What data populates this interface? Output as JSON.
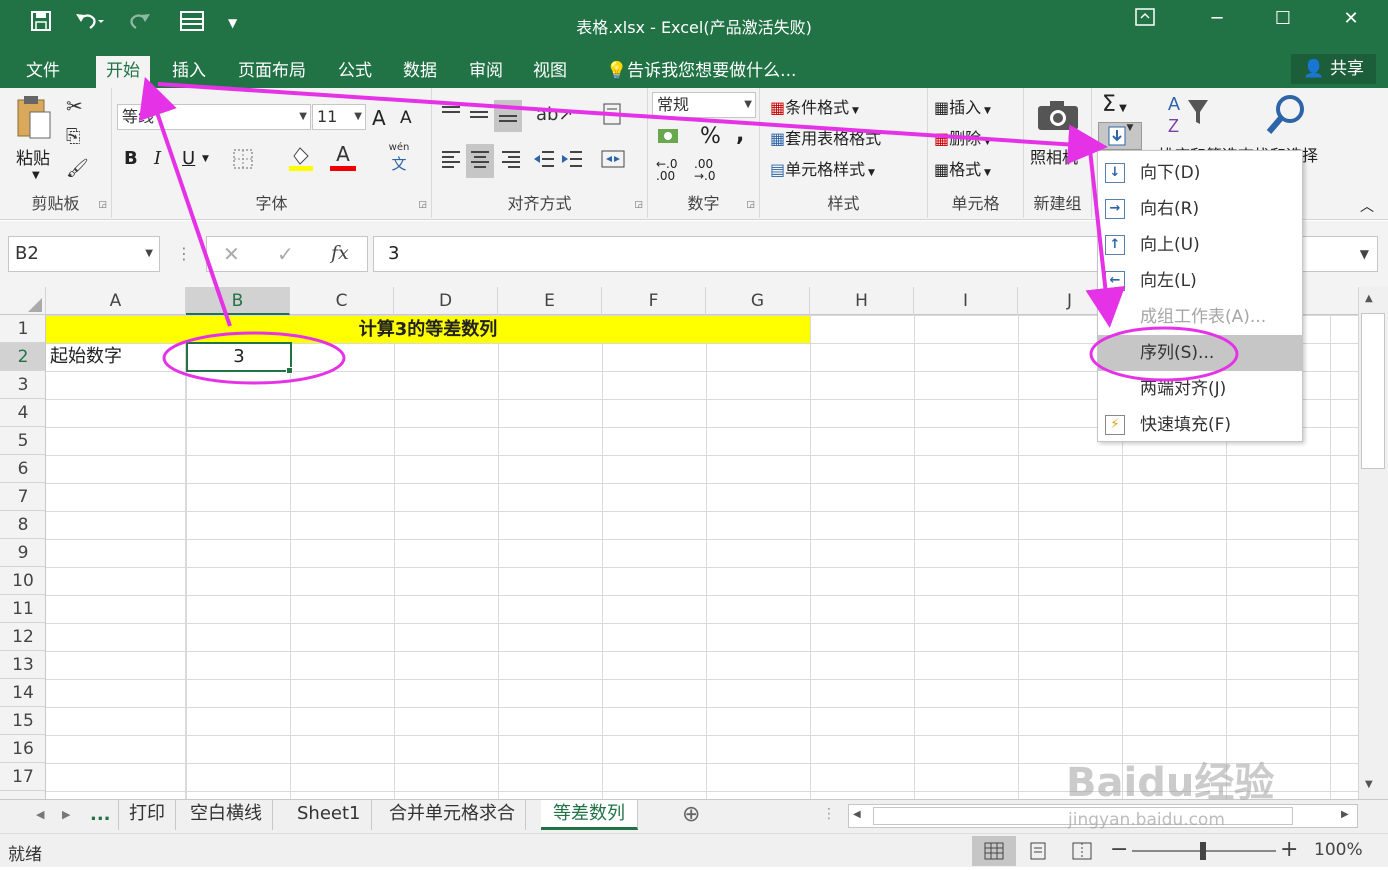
{
  "window": {
    "title": "表格.xlsx - Excel(产品激活失败)"
  },
  "quick_access": {
    "save_icon": "save-icon",
    "undo_icon": "undo-icon",
    "redo_icon": "redo-icon",
    "customize_icon": "customize-icon"
  },
  "tabs": [
    {
      "label": "文件"
    },
    {
      "label": "开始",
      "active": true
    },
    {
      "label": "插入"
    },
    {
      "label": "页面布局"
    },
    {
      "label": "公式"
    },
    {
      "label": "数据"
    },
    {
      "label": "审阅"
    },
    {
      "label": "视图"
    }
  ],
  "tell_me": "告诉我您想要做什么...",
  "share": "共享",
  "ribbon": {
    "clipboard": {
      "label": "剪贴板",
      "paste": "粘贴"
    },
    "font": {
      "label": "字体",
      "font_name": "等线",
      "font_size": "11",
      "grow": "A",
      "shrink": "A",
      "bold": "B",
      "italic": "I",
      "underline": "U",
      "font_color_letter": "A",
      "phonetic": "wén",
      "phonetic_char": "文"
    },
    "alignment": {
      "label": "对齐方式"
    },
    "number": {
      "label": "数字",
      "format": "常规",
      "percent": "%",
      "comma": ",",
      "inc_decimal_top": "←.0",
      "inc_decimal_bottom": ".00",
      "dec_decimal_top": ".00",
      "dec_decimal_bottom": "→.0"
    },
    "styles": {
      "label": "样式",
      "conditional": "条件格式",
      "table": "套用表格格式",
      "cell_styles": "单元格样式"
    },
    "cells": {
      "label": "单元格",
      "insert": "插入",
      "delete": "删除",
      "format": "格式"
    },
    "new_group": {
      "label": "新建组",
      "camera": "照相机"
    },
    "editing": {
      "sum": "Σ",
      "sort": "排序和筛选",
      "find": "查找和选择"
    }
  },
  "formula_bar": {
    "name_box": "B2",
    "fx": "fx",
    "value": "3"
  },
  "columns": [
    "A",
    "B",
    "C",
    "D",
    "E",
    "F",
    "G",
    "H",
    "I",
    "J"
  ],
  "rows": [
    "1",
    "2",
    "3",
    "4",
    "5",
    "6",
    "7",
    "8",
    "9",
    "10",
    "11",
    "12",
    "13",
    "14",
    "15",
    "16",
    "17"
  ],
  "cells": {
    "title": "计算3的等差数列",
    "a2": "起始数字",
    "b2": "3"
  },
  "fill_menu": [
    {
      "label": "向下(D)",
      "icon": "arrow-down-icon"
    },
    {
      "label": "向右(R)",
      "icon": "arrow-right-icon"
    },
    {
      "label": "向上(U)",
      "icon": "arrow-up-icon"
    },
    {
      "label": "向左(L)",
      "icon": "arrow-left-icon"
    },
    {
      "label": "成组工作表(A)...",
      "disabled": true
    },
    {
      "label": "序列(S)...",
      "highlighted": true
    },
    {
      "label": "两端对齐(J)"
    },
    {
      "label": "快速填充(F)",
      "icon": "flash-fill-icon"
    }
  ],
  "sheets": {
    "more": "...",
    "tabs": [
      "打印",
      "空白横线",
      "Sheet1",
      "合并单元格求合",
      "等差数列"
    ],
    "active": "等差数列"
  },
  "status": {
    "ready": "就绪",
    "zoom": "100%"
  },
  "watermark": {
    "brand": "Baidu经验",
    "url": "jingyan.baidu.com"
  },
  "colors": {
    "excel_green": "#217346",
    "title_fill": "#ffff00",
    "annotation": "#e632e6"
  }
}
